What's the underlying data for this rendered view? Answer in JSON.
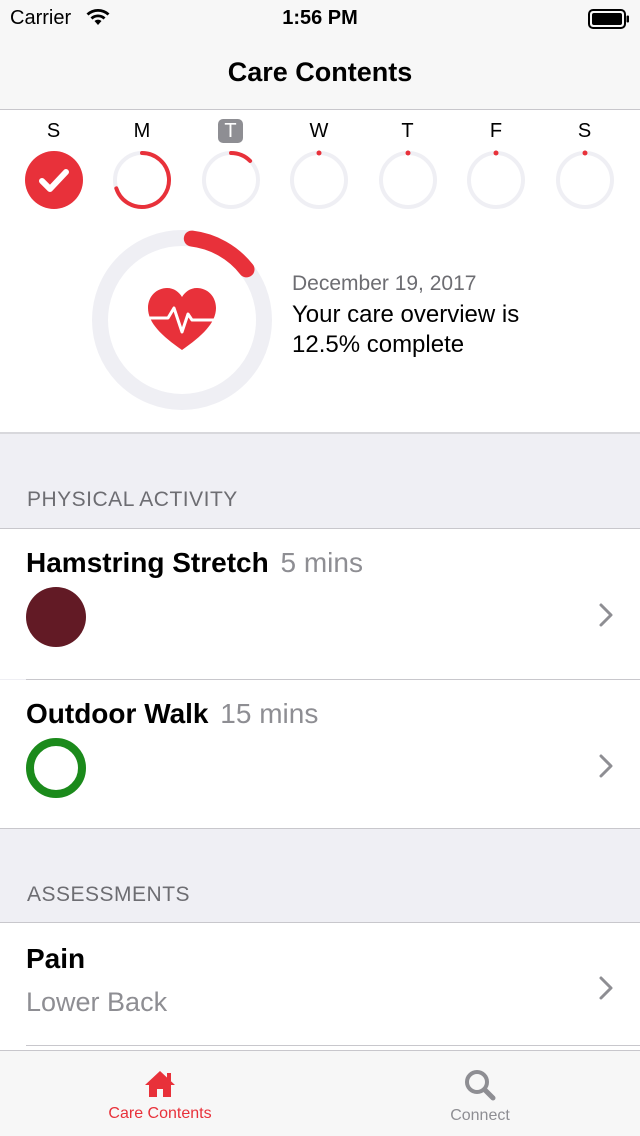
{
  "status_bar": {
    "carrier": "Carrier",
    "time": "1:56 PM"
  },
  "nav": {
    "title": "Care Contents"
  },
  "week": [
    {
      "letter": "S",
      "progress": 1.0,
      "completed": true,
      "selected": false
    },
    {
      "letter": "M",
      "progress": 0.7,
      "completed": false,
      "selected": false
    },
    {
      "letter": "T",
      "progress": 0.125,
      "completed": false,
      "selected": true
    },
    {
      "letter": "W",
      "progress": 0.0,
      "completed": false,
      "selected": false
    },
    {
      "letter": "T",
      "progress": 0.0,
      "completed": false,
      "selected": false
    },
    {
      "letter": "F",
      "progress": 0.0,
      "completed": false,
      "selected": false
    },
    {
      "letter": "S",
      "progress": 0.0,
      "completed": false,
      "selected": false
    }
  ],
  "overview": {
    "date": "December 19, 2017",
    "description": "Your care overview is 12.5% complete",
    "progress": 0.125
  },
  "sections": {
    "physical_activity": "PHYSICAL ACTIVITY",
    "assessments": "ASSESSMENTS"
  },
  "activities": [
    {
      "title": "Hamstring Stretch",
      "duration": "5 mins",
      "color": "#621a25",
      "filled": true
    },
    {
      "title": "Outdoor Walk",
      "duration": "15 mins",
      "color": "#1b8a1b",
      "filled": false
    }
  ],
  "assessments": [
    {
      "title": "Pain",
      "subtitle": "Lower Back"
    }
  ],
  "tabs": [
    {
      "label": "Care Contents",
      "icon": "home-icon",
      "active": true
    },
    {
      "label": "Connect",
      "icon": "search-icon",
      "active": false
    }
  ],
  "colors": {
    "accent": "#e8313a",
    "ring_track": "#efeff4",
    "inactive": "#8e8e93"
  }
}
